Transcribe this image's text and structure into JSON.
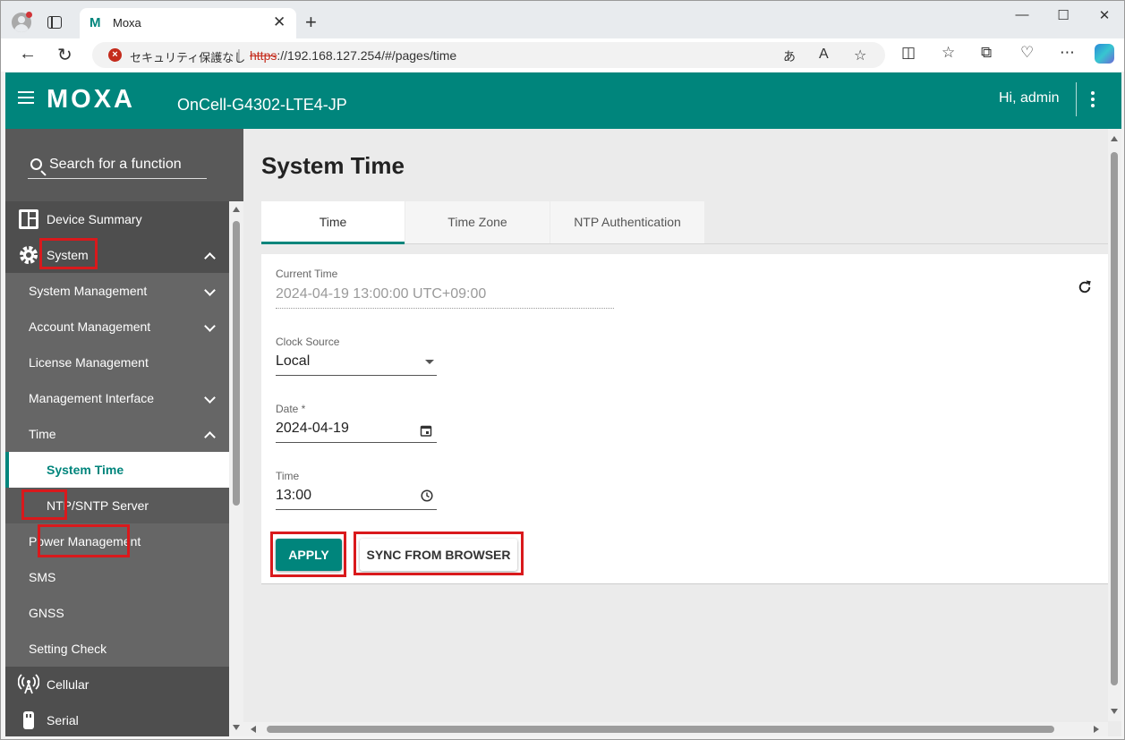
{
  "browser": {
    "tab_title": "Moxa",
    "tab_favicon": "M",
    "security_text": "セキュリティ保護なし",
    "url_scheme": "https",
    "url_rest": "://192.168.127.254/#/pages/time",
    "icons": [
      "profile-icon",
      "tabs-icon",
      "close-icon",
      "new-tab-icon",
      "minimize-icon",
      "maximize-icon",
      "window-close-icon",
      "back-icon",
      "reload-icon",
      "security-warning-icon",
      "read-aloud-icon",
      "translate-icon",
      "favorite-icon",
      "split-screen-icon",
      "favorites-icon",
      "collections-icon",
      "browser-essentials-icon",
      "more-icon",
      "copilot-icon"
    ]
  },
  "app": {
    "brand": "MOXA",
    "model": "OnCell-G4302-LTE4-JP",
    "greeting": "Hi, admin",
    "accent_color": "#00857c",
    "highlight_color": "#d9191c"
  },
  "sidebar": {
    "search_placeholder": "Search for a function",
    "items": [
      {
        "label": "Device Summary"
      },
      {
        "label": "System"
      },
      {
        "label": "System Management"
      },
      {
        "label": "Account Management"
      },
      {
        "label": "License Management"
      },
      {
        "label": "Management Interface"
      },
      {
        "label": "Time"
      },
      {
        "label": "System Time"
      },
      {
        "label": "NTP/SNTP Server"
      },
      {
        "label": "Power Management"
      },
      {
        "label": "SMS"
      },
      {
        "label": "GNSS"
      },
      {
        "label": "Setting Check"
      },
      {
        "label": "Cellular"
      },
      {
        "label": "Serial"
      }
    ]
  },
  "main": {
    "title": "System Time",
    "tabs": [
      {
        "label": "Time"
      },
      {
        "label": "Time Zone"
      },
      {
        "label": "NTP Authentication"
      }
    ],
    "current_time_label": "Current Time",
    "current_time_value": "2024-04-19 13:00:00 UTC+09:00",
    "clock_source_label": "Clock Source",
    "clock_source_value": "Local",
    "date_label": "Date *",
    "date_value": "2024-04-19",
    "time_label": "Time",
    "time_value": "13:00",
    "apply_label": "APPLY",
    "sync_label": "SYNC FROM BROWSER"
  }
}
